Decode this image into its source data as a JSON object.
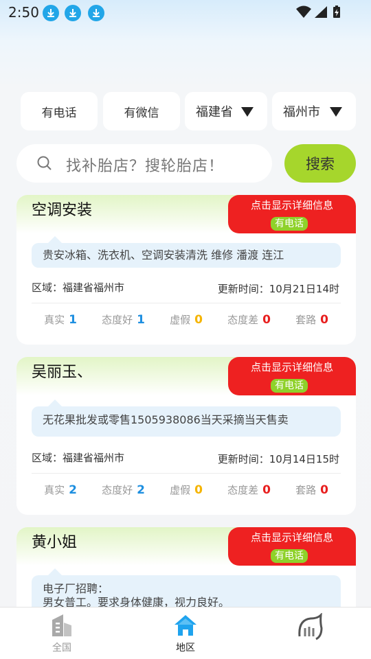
{
  "status": {
    "time": "2:50"
  },
  "filters": {
    "phone": "有电话",
    "wechat": "有微信",
    "province": "福建省",
    "city": "福州市"
  },
  "search": {
    "placeholder": "找补胎店？搜轮胎店！",
    "button": "搜索"
  },
  "labels": {
    "detail": "点击显示详细信息",
    "region_prefix": "区域：",
    "updated_prefix": "更新时间：",
    "real": "真实",
    "good": "态度好",
    "fake": "虚假",
    "bad": "态度差",
    "scam": "套路"
  },
  "cards": [
    {
      "title": "空调安装",
      "badge": "有电话",
      "desc": "贵安冰箱、洗衣机、空调安装清洗 维修 潘渡 连江",
      "region": "福建省福州市",
      "updated": "10月21日14时",
      "real": "1",
      "good": "1",
      "fake": "0",
      "bad": "0",
      "scam": "0"
    },
    {
      "title": "吴丽玉、",
      "badge": "有电话",
      "desc": "无花果批发或零售1505938086当天采摘当天售卖",
      "region": "福建省福州市",
      "updated": "10月14日15时",
      "real": "2",
      "good": "2",
      "fake": "0",
      "bad": "0",
      "scam": "0"
    },
    {
      "title": "黄小姐",
      "badge": "有电话",
      "desc_line1": "电子厂招聘：",
      "desc_line2": "男女普工。要求身体健康，视力良好。"
    }
  ],
  "nav": {
    "all": "全国",
    "region": "地区"
  },
  "colors": {
    "accent_green": "#a6d62c",
    "detail_red": "#ee2121",
    "count_blue": "#1e8fe0"
  }
}
